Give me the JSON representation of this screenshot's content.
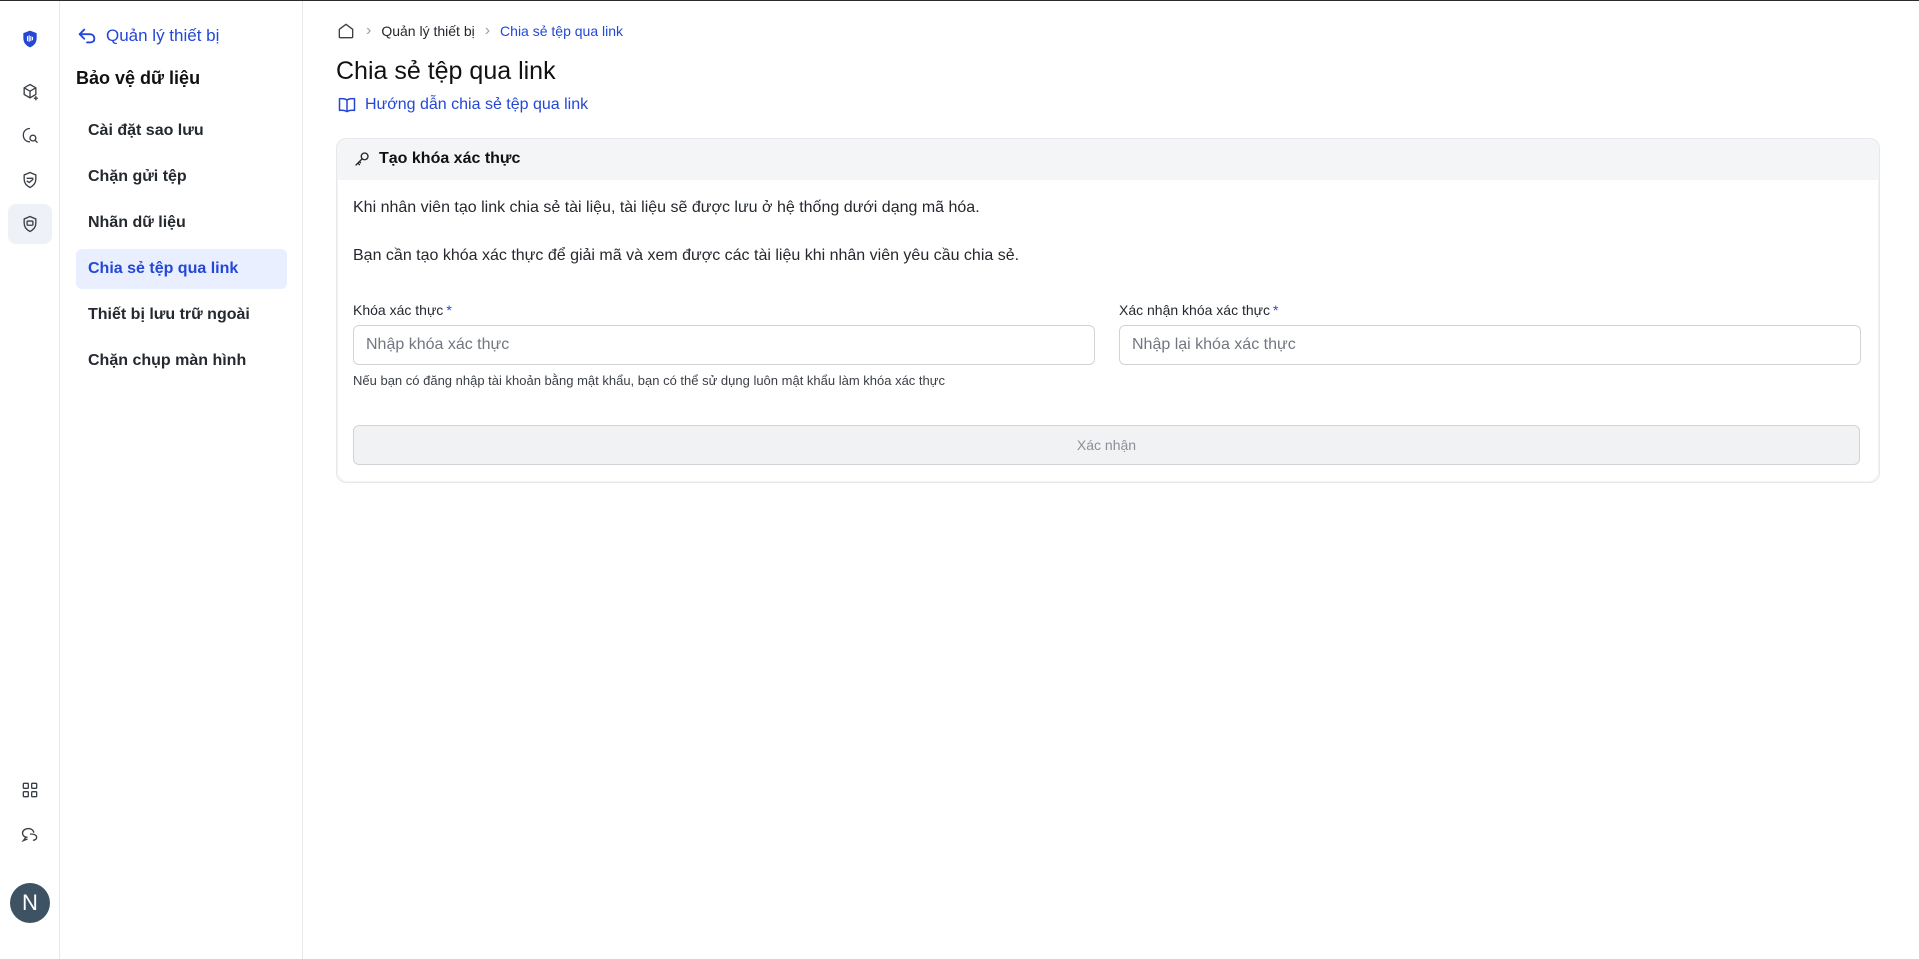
{
  "rail": {
    "items": [
      {
        "icon": "shield-logo-icon"
      },
      {
        "icon": "cube-plus-icon"
      },
      {
        "icon": "search-device-icon"
      },
      {
        "icon": "shield-check-icon"
      },
      {
        "icon": "shield-data-icon"
      }
    ],
    "bottom_items": [
      {
        "icon": "apps-grid-icon"
      },
      {
        "icon": "chat-icon"
      }
    ],
    "avatar_initial": "N"
  },
  "subnav": {
    "back_label": "Quản lý thiết bị",
    "section_title": "Bảo vệ dữ liệu",
    "items": [
      {
        "label": "Cài đặt sao lưu",
        "active": false
      },
      {
        "label": "Chặn gửi tệp",
        "active": false
      },
      {
        "label": "Nhãn dữ liệu",
        "active": false
      },
      {
        "label": "Chia sẻ tệp qua link",
        "active": true
      },
      {
        "label": "Thiết bị lưu trữ ngoài",
        "active": false
      },
      {
        "label": "Chặn chụp màn hình",
        "active": false
      }
    ]
  },
  "breadcrumb": {
    "home_icon": "home-icon",
    "items": [
      "Quản lý thiết bị",
      "Chia sẻ tệp qua link"
    ]
  },
  "page": {
    "title": "Chia sẻ tệp qua link",
    "guide_link": "Hướng dẫn chia sẻ tệp qua link"
  },
  "card": {
    "header": "Tạo khóa xác thực",
    "paragraph_1": "Khi nhân viên tạo link chia sẻ tài liệu, tài liệu sẽ được lưu ở hệ thống dưới dạng mã hóa.",
    "paragraph_2": "Bạn cần tạo khóa xác thực để giải mã và xem được các tài liệu khi nhân viên yêu cầu chia sẻ.",
    "key_label": "Khóa xác thực",
    "key_placeholder": "Nhập khóa xác thực",
    "confirm_label": "Xác nhận khóa xác thực",
    "confirm_placeholder": "Nhập lại khóa xác thực",
    "required_mark": "*",
    "hint": "Nếu bạn có đăng nhập tài khoản bằng mật khẩu, bạn có thể sử dụng luôn mật khẩu làm khóa xác thực",
    "submit_label": "Xác nhận"
  },
  "colors": {
    "accent": "#2447d6",
    "active_bg": "#e9efff",
    "avatar_bg": "#3d5363"
  }
}
